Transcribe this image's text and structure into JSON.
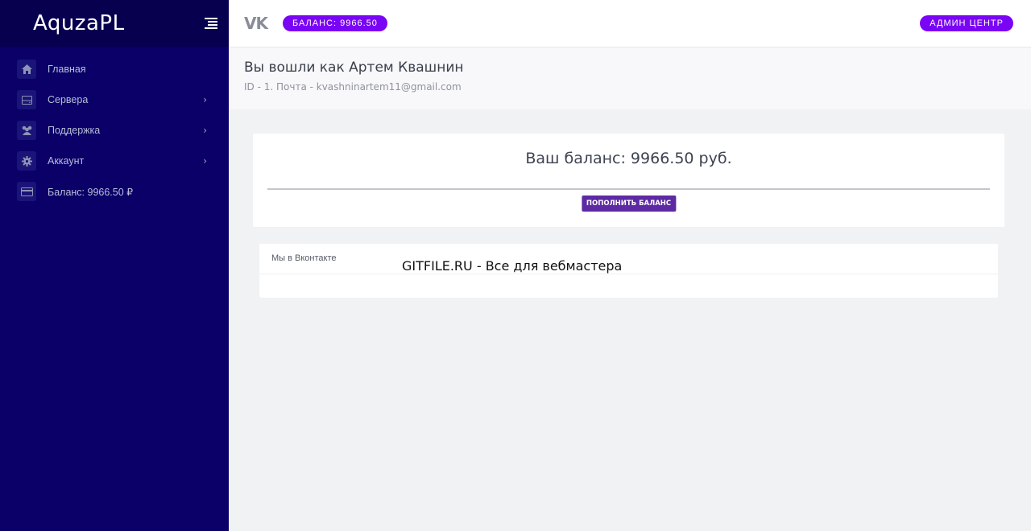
{
  "sidebar": {
    "brand": "AquzaPL",
    "items": [
      {
        "label": "Главная",
        "icon": "home-icon",
        "has_arrow": false
      },
      {
        "label": "Сервера",
        "icon": "server-icon",
        "has_arrow": true
      },
      {
        "label": "Поддержка",
        "icon": "users-icon",
        "has_arrow": true
      },
      {
        "label": "Аккаунт",
        "icon": "gear-icon",
        "has_arrow": true
      },
      {
        "label": "Баланс: 9966.50 ₽",
        "icon": "credit-card-icon",
        "has_arrow": false
      }
    ],
    "arrow_glyph": "›"
  },
  "topbar": {
    "vk_logo": "VK",
    "balance_pill": "БАЛАНС: 9966.50",
    "admin_button": "АДМИН ЦЕНТР"
  },
  "header": {
    "title": "Вы вошли как Артем Квашнин",
    "subtitle": "ID - 1. Почта - kvashninartem11@gmail.com"
  },
  "balance_card": {
    "text": "Ваш баланс: 9966.50 руб.",
    "button": "ПОПОЛНИТЬ БАЛАНС"
  },
  "vk_card": {
    "title": "Мы в Вконтакте"
  },
  "watermark": "GITFILE.RU - Все для вебмастера",
  "colors": {
    "sidebar_bg": "#0a0068",
    "brand_bg": "#07004f",
    "accent": "#7a05f5",
    "button": "#5e2aa3"
  }
}
